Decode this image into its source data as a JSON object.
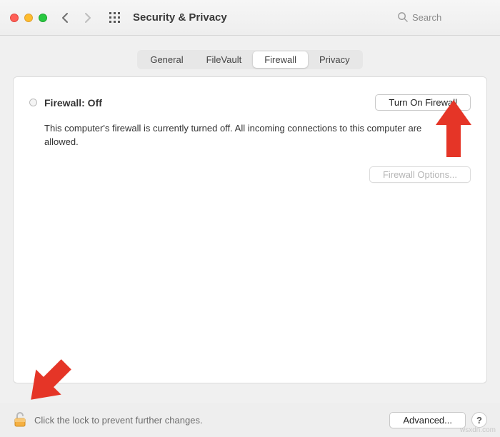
{
  "window": {
    "title": "Security & Privacy"
  },
  "search": {
    "placeholder": "Search"
  },
  "tabs": [
    {
      "label": "General"
    },
    {
      "label": "FileVault"
    },
    {
      "label": "Firewall"
    },
    {
      "label": "Privacy"
    }
  ],
  "active_tab_index": 2,
  "firewall": {
    "status_title": "Firewall: Off",
    "turn_on_label": "Turn On Firewall",
    "description": "This computer's firewall is currently turned off. All incoming connections to this computer are allowed.",
    "options_label": "Firewall Options..."
  },
  "footer": {
    "lock_hint": "Click the lock to prevent further changes.",
    "advanced_label": "Advanced...",
    "help_label": "?"
  },
  "watermark": "wsxdn.com"
}
